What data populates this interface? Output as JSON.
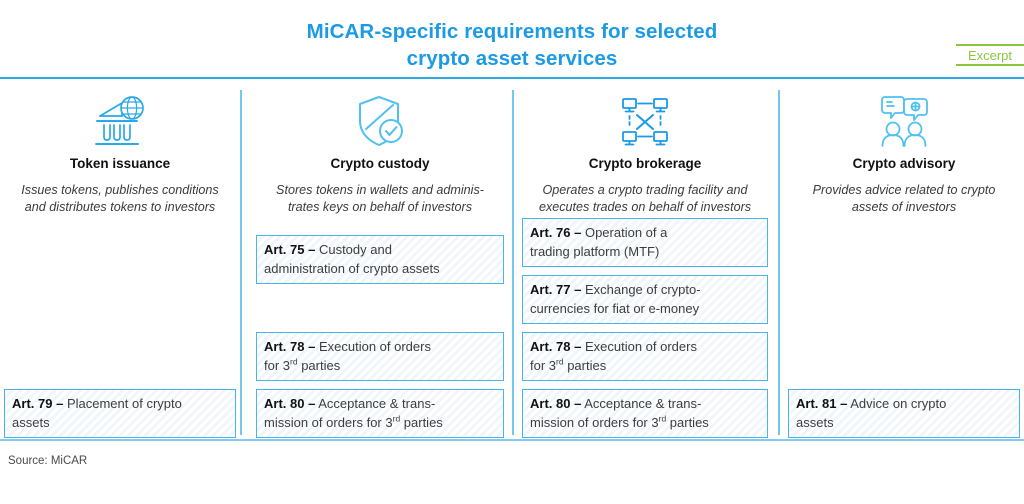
{
  "header": {
    "title_line1": "MiCAR-specific requirements for selected",
    "title_line2": "crypto asset services",
    "excerpt_label": "Excerpt",
    "title_color": "#1b9ae6",
    "excerpt_color": "#8cc63f",
    "rule_color": "#29a9e8"
  },
  "columns": [
    {
      "icon": "bank-globe-icon",
      "title": "Token issuance",
      "description_line1": "Issues tokens, publishes conditions",
      "description_line2": "and distributes tokens to investors",
      "articles": [
        {
          "article": "Art. 79",
          "dash": "–",
          "text_line1": "Placement of crypto",
          "text_line2": "assets"
        }
      ]
    },
    {
      "icon": "shield-check-icon",
      "title": "Crypto custody",
      "description_line1": "Stores tokens in wallets and adminis-",
      "description_line2": "trates keys on behalf of investors",
      "articles": [
        {
          "article": "Art. 75",
          "dash": "–",
          "text_line1": "Custody and",
          "text_line2": "administration of crypto assets"
        },
        {
          "article": "Art. 78",
          "dash": "–",
          "text_line1": "Execution of orders",
          "text_line2": "for 3rd parties"
        },
        {
          "article": "Art. 80",
          "dash": "–",
          "text_line1": "Acceptance & trans-",
          "text_line2": "mission of orders for 3rd parties"
        }
      ]
    },
    {
      "icon": "network-nodes-icon",
      "title": "Crypto brokerage",
      "description_line1": "Operates a crypto trading facility and",
      "description_line2": "executes trades on behalf of investors",
      "articles": [
        {
          "article": "Art. 76",
          "dash": "–",
          "text_line1": "Operation of a",
          "text_line2": "trading platform (MTF)"
        },
        {
          "article": "Art. 77",
          "dash": "–",
          "text_line1": "Exchange of crypto-",
          "text_line2": "currencies for fiat or e-money"
        },
        {
          "article": "Art. 78",
          "dash": "–",
          "text_line1": "Execution of orders",
          "text_line2": "for 3rd parties"
        },
        {
          "article": "Art. 80",
          "dash": "–",
          "text_line1": "Acceptance & trans-",
          "text_line2": "mission of orders for 3rd parties"
        }
      ]
    },
    {
      "icon": "people-speech-bubbles-icon",
      "title": "Crypto advisory",
      "description_line1": "Provides advice related to crypto",
      "description_line2": "assets of investors",
      "articles": [
        {
          "article": "Art. 81",
          "dash": "–",
          "text_line1": "Advice on crypto",
          "text_line2": "assets"
        }
      ]
    }
  ],
  "footer": {
    "source": "Source: MiCAR"
  }
}
